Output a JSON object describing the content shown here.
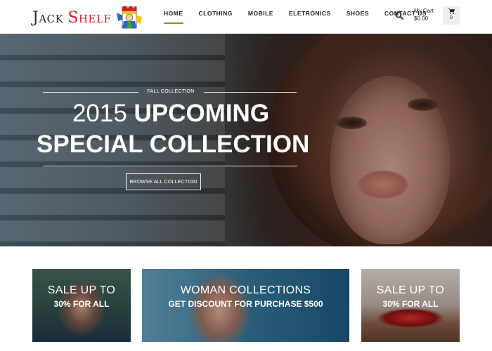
{
  "brand": {
    "word1": "Jack",
    "word2": "Shelf"
  },
  "nav": {
    "items": [
      {
        "label": "HOME",
        "active": true
      },
      {
        "label": "CLOTHING",
        "active": false
      },
      {
        "label": "MOBILE",
        "active": false
      },
      {
        "label": "ELETRONICS",
        "active": false
      },
      {
        "label": "SHOES",
        "active": false
      },
      {
        "label": "CONTACT US",
        "active": false
      }
    ],
    "accent_color": "#6aa121"
  },
  "header": {
    "search_icon": "search-icon",
    "cart": {
      "title": "My Cart",
      "total": "$0.00",
      "count": "0",
      "icon": "cart-icon"
    }
  },
  "hero": {
    "kicker": "FALL COLLECTION",
    "title_year": "2015",
    "title_rest": "UPCOMING",
    "title_line2": "SPECIAL COLLECTION",
    "button_label": "BROWSE ALL COLLECTION"
  },
  "promos": [
    {
      "line1": "SALE UP TO",
      "line2": "30% FOR ALL"
    },
    {
      "line1": "WOMAN COLLECTIONS",
      "line2": "GET DISCOUNT FOR PURCHASE $500"
    },
    {
      "line1": "SALE UP TO",
      "line2": "30% FOR ALL"
    }
  ],
  "colors": {
    "brand_red": "#d21f26",
    "nav_text": "#222222"
  }
}
